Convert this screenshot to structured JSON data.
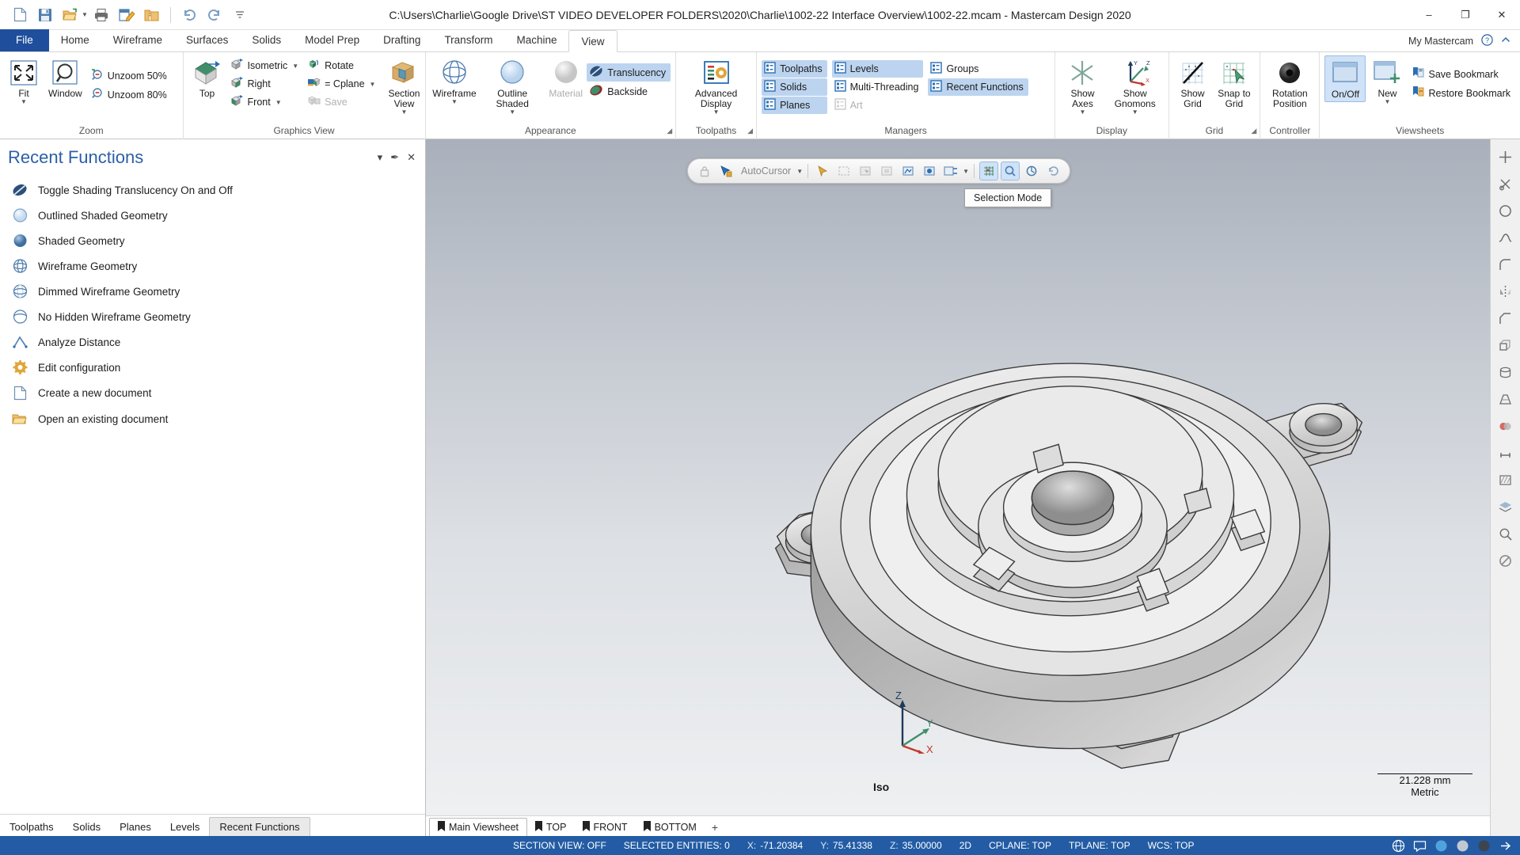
{
  "titlebar": {
    "title": "C:\\Users\\Charlie\\Google Drive\\ST VIDEO DEVELOPER FOLDERS\\2020\\Charlie\\1002-22 Interface Overview\\1002-22.mcam - Mastercam Design 2020",
    "quick_access": [
      {
        "name": "new-document-icon",
        "label": "New"
      },
      {
        "name": "save-icon",
        "label": "Save"
      },
      {
        "name": "open-folder-icon",
        "label": "Open"
      },
      {
        "name": "print-icon",
        "label": "Print"
      },
      {
        "name": "edit-document-icon",
        "label": "Edit"
      },
      {
        "name": "zip-folder-icon",
        "label": "Zip2Go"
      },
      {
        "name": "undo-icon",
        "label": "Undo"
      },
      {
        "name": "redo-icon",
        "label": "Redo"
      },
      {
        "name": "customize-qat-icon",
        "label": "Customize Quick Access Toolbar"
      }
    ],
    "window_buttons": {
      "minimize": "–",
      "maximize": "❐",
      "close": "✕"
    }
  },
  "ribbon": {
    "file_tab": "File",
    "tabs": [
      "Home",
      "Wireframe",
      "Surfaces",
      "Solids",
      "Model Prep",
      "Drafting",
      "Transform",
      "Machine",
      "View"
    ],
    "active_tab": "View",
    "right": {
      "account": "My Mastercam",
      "help": "?",
      "minimize_ribbon": "⌃"
    },
    "groups": [
      {
        "label": "Zoom",
        "big": [
          {
            "name": "fit-button",
            "label": "Fit",
            "icon": "fit-icon",
            "caret": true,
            "state": "normal"
          },
          {
            "name": "window-zoom-button",
            "label": "Window",
            "icon": "zoom-window-icon",
            "caret": false,
            "state": "normal"
          }
        ],
        "small": [
          {
            "name": "unzoom-50-button",
            "label": "Unzoom 50%",
            "icon": "unzoom-icon"
          },
          {
            "name": "unzoom-80-button",
            "label": "Unzoom 80%",
            "icon": "unzoom-icon"
          }
        ]
      },
      {
        "label": "Graphics View",
        "big": [
          {
            "name": "top-view-button",
            "label": "Top",
            "icon": "top-view-cube-icon",
            "caret": false,
            "state": "normal"
          },
          {
            "name": "section-view-button",
            "label": "Section View",
            "icon": "section-view-icon",
            "caret": true,
            "state": "normal"
          }
        ],
        "small": [
          {
            "name": "isometric-view-button",
            "label": "Isometric",
            "icon": "iso-cube-icon",
            "caret": true
          },
          {
            "name": "right-view-button",
            "label": "Right",
            "icon": "right-cube-icon",
            "caret": false
          },
          {
            "name": "front-view-button",
            "label": "Front",
            "icon": "front-cube-icon",
            "caret": true
          }
        ],
        "small2": [
          {
            "name": "rotate-view-button",
            "label": "Rotate",
            "icon": "rotate-icon",
            "caret": false
          },
          {
            "name": "equals-cplane-button",
            "label": "= Cplane",
            "icon": "cplane-icon",
            "caret": true
          },
          {
            "name": "save-view-button",
            "label": "Save",
            "icon": "save-view-icon",
            "caret": false,
            "dim": true
          }
        ]
      },
      {
        "label": "Appearance",
        "dialog_launcher": true,
        "big": [
          {
            "name": "wireframe-button",
            "label": "Wireframe",
            "icon": "wireframe-globe-icon",
            "caret": true,
            "state": "normal"
          },
          {
            "name": "outline-shaded-button",
            "label": "Outline Shaded",
            "icon": "outline-shaded-sphere-icon",
            "caret": true,
            "state": "normal"
          },
          {
            "name": "material-button",
            "label": "Material",
            "icon": "material-sphere-icon",
            "caret": false,
            "state": "disabled"
          }
        ],
        "small": [
          {
            "name": "translucency-toggle",
            "label": "Translucency",
            "icon": "translucency-icon",
            "active": true
          },
          {
            "name": "backside-toggle",
            "label": "Backside",
            "icon": "backside-icon",
            "active": false
          }
        ]
      },
      {
        "label": "Toolpaths",
        "dialog_launcher": true,
        "big": [
          {
            "name": "advanced-display-button",
            "label": "Advanced Display",
            "icon": "advanced-display-icon",
            "caret": true,
            "state": "normal"
          }
        ]
      },
      {
        "label": "Managers",
        "col1": [
          {
            "name": "manager-toolpaths-toggle",
            "label": "Toolpaths",
            "active": true
          },
          {
            "name": "manager-solids-toggle",
            "label": "Solids",
            "active": true
          },
          {
            "name": "manager-planes-toggle",
            "label": "Planes",
            "active": true
          }
        ],
        "col2": [
          {
            "name": "manager-levels-toggle",
            "label": "Levels",
            "active": true
          },
          {
            "name": "manager-multithreading-toggle",
            "label": "Multi-Threading",
            "active": false
          },
          {
            "name": "manager-art-toggle",
            "label": "Art",
            "active": false,
            "dim": true
          }
        ],
        "col3": [
          {
            "name": "manager-groups-toggle",
            "label": "Groups",
            "active": false
          },
          {
            "name": "manager-recent-functions-toggle",
            "label": "Recent Functions",
            "active": true
          }
        ]
      },
      {
        "label": "Display",
        "big": [
          {
            "name": "show-axes-button",
            "label": "Show Axes",
            "icon": "axes-icon",
            "caret": true,
            "state": "normal"
          },
          {
            "name": "show-gnomons-button",
            "label": "Show Gnomons",
            "icon": "gnomon-icon",
            "caret": true,
            "state": "normal"
          }
        ]
      },
      {
        "label": "Grid",
        "dialog_launcher": true,
        "big": [
          {
            "name": "show-grid-button",
            "label": "Show Grid",
            "icon": "show-grid-icon",
            "caret": false,
            "state": "normal"
          },
          {
            "name": "snap-to-grid-button",
            "label": "Snap to Grid",
            "icon": "snap-grid-icon",
            "caret": false,
            "state": "normal"
          }
        ]
      },
      {
        "label": "Controller",
        "big": [
          {
            "name": "rotation-position-button",
            "label": "Rotation Position",
            "icon": "rotation-position-icon",
            "caret": false,
            "state": "normal"
          }
        ]
      },
      {
        "label": "Viewsheets",
        "big": [
          {
            "name": "viewsheet-onoff-button",
            "label": "On/Off",
            "icon": "viewsheet-onoff-icon",
            "caret": false,
            "state": "active"
          },
          {
            "name": "viewsheet-new-button",
            "label": "New",
            "icon": "viewsheet-new-icon",
            "caret": true,
            "state": "normal"
          }
        ],
        "small": [
          {
            "name": "save-bookmark-button",
            "label": "Save Bookmark",
            "icon": "save-bookmark-icon"
          },
          {
            "name": "restore-bookmark-button",
            "label": "Restore Bookmark",
            "icon": "restore-bookmark-icon"
          }
        ]
      }
    ]
  },
  "recent_functions_panel": {
    "title": "Recent Functions",
    "header_buttons": [
      {
        "name": "panel-dropdown-button",
        "glyph": "▾"
      },
      {
        "name": "panel-pin-button",
        "glyph": "✒"
      },
      {
        "name": "panel-close-button",
        "glyph": "✕"
      }
    ],
    "items": [
      {
        "name": "recent-item-toggle-shading-translucency",
        "label": "Toggle Shading Translucency On and Off",
        "icon": "translucency-icon"
      },
      {
        "name": "recent-item-outlined-shaded-geometry",
        "label": "Outlined Shaded Geometry",
        "icon": "outline-shaded-sphere-icon"
      },
      {
        "name": "recent-item-shaded-geometry",
        "label": "Shaded Geometry",
        "icon": "shaded-sphere-icon"
      },
      {
        "name": "recent-item-wireframe-geometry",
        "label": "Wireframe Geometry",
        "icon": "wireframe-globe-icon"
      },
      {
        "name": "recent-item-dimmed-wireframe-geometry",
        "label": "Dimmed Wireframe Geometry",
        "icon": "dimmed-wireframe-icon"
      },
      {
        "name": "recent-item-no-hidden-wireframe-geometry",
        "label": "No Hidden Wireframe Geometry",
        "icon": "no-hidden-wireframe-icon"
      },
      {
        "name": "recent-item-analyze-distance",
        "label": "Analyze Distance",
        "icon": "analyze-distance-icon"
      },
      {
        "name": "recent-item-edit-configuration",
        "label": "Edit configuration",
        "icon": "gear-icon"
      },
      {
        "name": "recent-item-create-new-document",
        "label": "Create a new document",
        "icon": "new-document-icon"
      },
      {
        "name": "recent-item-open-existing-document",
        "label": "Open an existing document",
        "icon": "open-folder-icon"
      }
    ],
    "tabs": [
      {
        "name": "panel-tab-toolpaths",
        "label": "Toolpaths",
        "active": false
      },
      {
        "name": "panel-tab-solids",
        "label": "Solids",
        "active": false
      },
      {
        "name": "panel-tab-planes",
        "label": "Planes",
        "active": false
      },
      {
        "name": "panel-tab-levels",
        "label": "Levels",
        "active": false
      },
      {
        "name": "panel-tab-recent-functions",
        "label": "Recent Functions",
        "active": true
      }
    ]
  },
  "selection_toolbar": {
    "autocursor_label": "AutoCursor",
    "tooltip": "Selection Mode",
    "buttons": [
      {
        "name": "lock-autocursor-button",
        "icon": "lock-icon",
        "state": "dim"
      },
      {
        "name": "autocursor-icon-button",
        "icon": "autocursor-icon",
        "state": "normal"
      },
      {
        "name": "autocursor-dropdown-caret",
        "icon": "chevron-down-icon",
        "state": "normal"
      },
      {
        "name": "select-all-button",
        "icon": "select-all-icon",
        "state": "dim"
      },
      {
        "name": "select-only-button",
        "icon": "select-only-icon",
        "state": "normal"
      },
      {
        "name": "select-entity-button",
        "icon": "cursor-select-icon",
        "state": "normal"
      },
      {
        "name": "window-select-button",
        "icon": "window-select-icon",
        "state": "normal"
      },
      {
        "name": "polygon-select-button",
        "icon": "polygon-select-icon",
        "state": "normal"
      },
      {
        "name": "vector-select-button",
        "icon": "vector-select-icon",
        "state": "normal"
      },
      {
        "name": "chain-select-button",
        "icon": "chain-select-icon",
        "state": "normal"
      },
      {
        "name": "solid-face-select-button",
        "icon": "solid-face-icon",
        "state": "normal"
      },
      {
        "name": "selection-mode-caret",
        "icon": "chevron-down-icon",
        "state": "normal"
      },
      {
        "name": "selection-mode-button",
        "icon": "selection-mode-icon",
        "state": "active"
      },
      {
        "name": "selection-filter-button",
        "icon": "filter-icon",
        "state": "active"
      },
      {
        "name": "end-selection-button",
        "icon": "end-selection-icon",
        "state": "normal"
      },
      {
        "name": "undo-selection-button",
        "icon": "undo-selection-icon",
        "state": "normal"
      }
    ]
  },
  "viewport": {
    "view_name": "Iso",
    "scale_value": "21.228 mm",
    "units": "Metric",
    "gnomon": {
      "x": "X",
      "y": "Y",
      "z": "Z"
    }
  },
  "right_toolbar": [
    {
      "name": "fit-screen-icon"
    },
    {
      "name": "cut-icon"
    },
    {
      "name": "circle-icon"
    },
    {
      "name": "spline-icon"
    },
    {
      "name": "fillet-icon"
    },
    {
      "name": "mirror-icon"
    },
    {
      "name": "chamfer-icon"
    },
    {
      "name": "extrude-icon"
    },
    {
      "name": "revolve-icon"
    },
    {
      "name": "loft-icon"
    },
    {
      "name": "boolean-icon"
    },
    {
      "name": "dimension-icon"
    },
    {
      "name": "hatch-icon"
    },
    {
      "name": "layers-icon"
    },
    {
      "name": "analyze-icon"
    },
    {
      "name": "no-entry-icon"
    }
  ],
  "viewsheets": {
    "tabs": [
      {
        "name": "viewsheet-tab-main",
        "label": "Main Viewsheet",
        "active": true
      },
      {
        "name": "viewsheet-tab-top",
        "label": "TOP",
        "active": false
      },
      {
        "name": "viewsheet-tab-front",
        "label": "FRONT",
        "active": false
      },
      {
        "name": "viewsheet-tab-bottom",
        "label": "BOTTOM",
        "active": false
      }
    ],
    "add_label": "+"
  },
  "statusbar": {
    "section_view": "SECTION VIEW: OFF",
    "selected_entities": "SELECTED ENTITIES: 0",
    "x_key": "X:",
    "x_val": "-71.20384",
    "y_key": "Y:",
    "y_val": "75.41338",
    "z_key": "Z:",
    "z_val": "35.00000",
    "dimension_mode": "2D",
    "cplane": "CPLANE: TOP",
    "tplane": "TPLANE: TOP",
    "wcs": "WCS: TOP",
    "icons": [
      {
        "name": "globe-status-icon"
      },
      {
        "name": "chat-status-icon"
      },
      {
        "name": "blue-circle-status-icon"
      },
      {
        "name": "grey-circle-status-icon"
      },
      {
        "name": "dark-circle-status-icon"
      },
      {
        "name": "expand-status-icon"
      }
    ]
  },
  "colors": {
    "accent": "#235ca4",
    "file_tab": "#1f4e9c",
    "highlight": "#cfe2f7",
    "panel_title": "#2c5fa8"
  }
}
